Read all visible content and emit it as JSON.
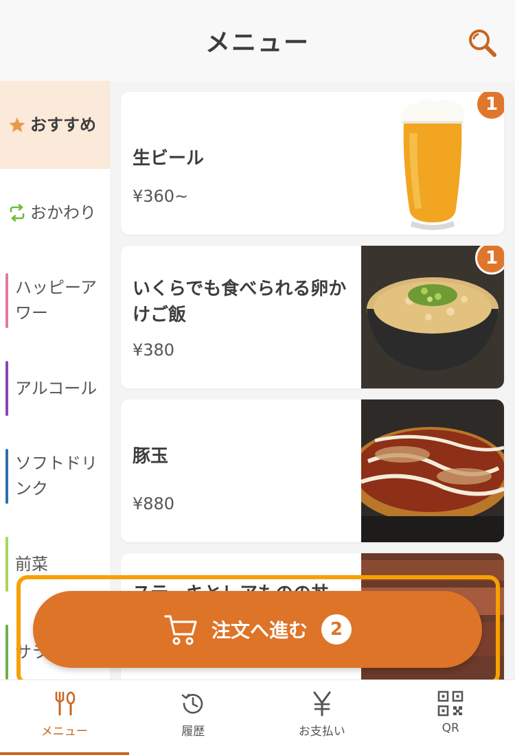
{
  "header": {
    "title": "メニュー",
    "search_icon": "search-icon"
  },
  "sidebar": {
    "items": [
      {
        "label": "おすすめ",
        "icon": "star-icon",
        "active": true
      },
      {
        "label": "おかわり",
        "icon": "refresh-icon"
      },
      {
        "label": "ハッピーアワー",
        "accent": "#e07aa0"
      },
      {
        "label": "アルコール",
        "accent": "#8e44ad"
      },
      {
        "label": "ソフトドリンク",
        "accent": "#2f6fa8"
      },
      {
        "label": "前菜",
        "accent": "#a8d65a"
      },
      {
        "label": "サラダ",
        "accent": "#6db04f"
      }
    ]
  },
  "menu": {
    "items": [
      {
        "name": "生ビール",
        "price": "¥360~",
        "badge": "1"
      },
      {
        "name": "いくらでも食べられる卵かけご飯",
        "price": "¥380",
        "badge": "1"
      },
      {
        "name": "豚玉",
        "price": "¥880"
      },
      {
        "name": "ステーキとレアものの丼",
        "price": ""
      }
    ]
  },
  "order_button": {
    "label": "注文へ進む",
    "count": "2",
    "icon": "cart-icon"
  },
  "bottom_nav": {
    "items": [
      {
        "label": "メニュー",
        "icon": "fork-spoon-icon",
        "active": true
      },
      {
        "label": "履歴",
        "icon": "history-icon"
      },
      {
        "label": "お支払い",
        "icon": "yen-icon"
      },
      {
        "label": "QR",
        "icon": "qr-icon"
      }
    ]
  },
  "colors": {
    "accent": "#de7427",
    "highlight": "#f7a000",
    "active_bg": "#fbe9d9"
  }
}
